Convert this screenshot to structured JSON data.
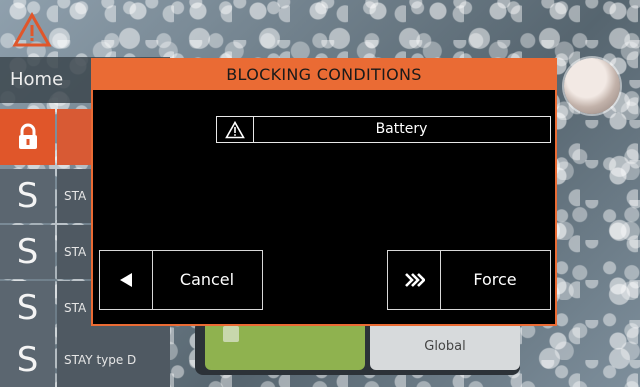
{
  "screen": {
    "home_label": "Home",
    "lock_icon": "lock-icon",
    "alert_icon": "warning-triangle-icon",
    "s_rows": [
      {
        "letter": "S",
        "text": "STA"
      },
      {
        "letter": "S",
        "text": "STA"
      },
      {
        "letter": "S",
        "text": "STA"
      },
      {
        "letter": "S",
        "text": "STAY   type D"
      }
    ],
    "under_panel": {
      "global_label": "Global"
    }
  },
  "dialog": {
    "title": "BLOCKING CONDITIONS",
    "conditions": [
      {
        "icon": "warning-triangle-icon",
        "label": "Battery"
      }
    ],
    "cancel": {
      "icon": "arrow-left-icon",
      "label": "Cancel"
    },
    "force": {
      "icon": "double-chevron-right-icon",
      "label": "Force"
    }
  },
  "colors": {
    "accent_orange": "#ea6b34",
    "dialog_bg": "#000000",
    "green": "#8fb24f"
  }
}
